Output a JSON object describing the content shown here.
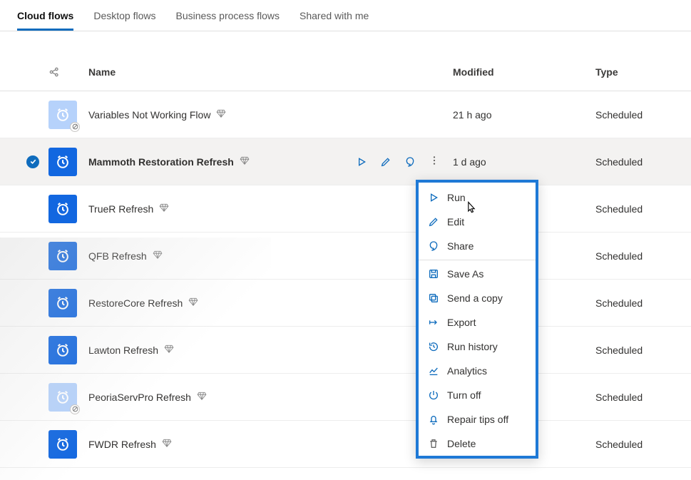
{
  "tabs": [
    {
      "label": "Cloud flows",
      "active": true
    },
    {
      "label": "Desktop flows",
      "active": false
    },
    {
      "label": "Business process flows",
      "active": false
    },
    {
      "label": "Shared with me",
      "active": false
    }
  ],
  "columns": {
    "name": "Name",
    "modified": "Modified",
    "type": "Type"
  },
  "rows": [
    {
      "name": "Variables Not Working Flow",
      "modified": "21 h ago",
      "type": "Scheduled",
      "disabled": true,
      "selected": false,
      "premium": true
    },
    {
      "name": "Mammoth Restoration Refresh",
      "modified": "1 d ago",
      "type": "Scheduled",
      "disabled": false,
      "selected": true,
      "premium": true
    },
    {
      "name": "TrueR Refresh",
      "modified": "",
      "type": "Scheduled",
      "disabled": false,
      "selected": false,
      "premium": true
    },
    {
      "name": "QFB Refresh",
      "modified": "",
      "type": "Scheduled",
      "disabled": false,
      "selected": false,
      "premium": true
    },
    {
      "name": "RestoreCore Refresh",
      "modified": "",
      "type": "Scheduled",
      "disabled": false,
      "selected": false,
      "premium": true
    },
    {
      "name": "Lawton Refresh",
      "modified": "",
      "type": "Scheduled",
      "disabled": false,
      "selected": false,
      "premium": true
    },
    {
      "name": "PeoriaServPro Refresh",
      "modified": "",
      "type": "Scheduled",
      "disabled": true,
      "selected": false,
      "premium": true
    },
    {
      "name": "FWDR Refresh",
      "modified": "",
      "type": "Scheduled",
      "disabled": false,
      "selected": false,
      "premium": true
    }
  ],
  "contextMenu": {
    "items": [
      {
        "label": "Run",
        "icon": "play"
      },
      {
        "label": "Edit",
        "icon": "pencil"
      },
      {
        "label": "Share",
        "icon": "share"
      },
      {
        "label": "Save As",
        "icon": "saveas",
        "divider_before": true
      },
      {
        "label": "Send a copy",
        "icon": "copy"
      },
      {
        "label": "Export",
        "icon": "export"
      },
      {
        "label": "Run history",
        "icon": "history"
      },
      {
        "label": "Analytics",
        "icon": "analytics"
      },
      {
        "label": "Turn off",
        "icon": "power"
      },
      {
        "label": "Repair tips off",
        "icon": "bell"
      },
      {
        "label": "Delete",
        "icon": "trash",
        "grey": true
      }
    ]
  }
}
